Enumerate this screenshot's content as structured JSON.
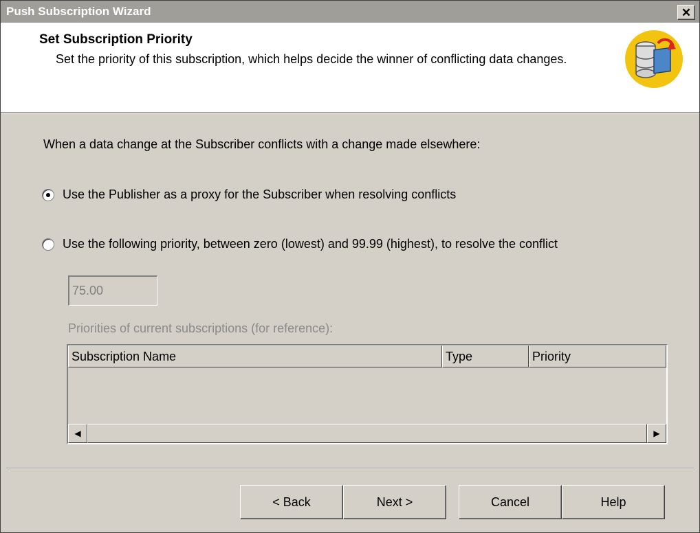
{
  "window": {
    "title": "Push Subscription Wizard",
    "close_glyph": "✕"
  },
  "header": {
    "title": "Set Subscription Priority",
    "subtitle": "Set the priority of this subscription, which helps decide the winner of conflicting data changes.",
    "icon": "database-sync-icon"
  },
  "main": {
    "prompt": "When a data change at the Subscriber conflicts with a change made elsewhere:",
    "options": [
      {
        "label": "Use the Publisher as a proxy for the Subscriber when resolving conflicts",
        "selected": true
      },
      {
        "label": "Use the following priority, between zero (lowest) and 99.99 (highest), to resolve the conflict",
        "selected": false
      }
    ],
    "priority_value": "75.00",
    "reference_label": "Priorities of current subscriptions (for reference):",
    "table": {
      "columns": [
        "Subscription Name",
        "Type",
        "Priority"
      ],
      "rows": []
    },
    "scroll_left_glyph": "◀",
    "scroll_right_glyph": "▶"
  },
  "footer": {
    "back_label": "< Back",
    "next_label": "Next >",
    "cancel_label": "Cancel",
    "help_label": "Help"
  },
  "colors": {
    "dialog_bg": "#d4d0c8",
    "titlebar_bg": "#a09e98",
    "header_bg": "#ffffff",
    "icon_accent": "#f2c40f"
  }
}
